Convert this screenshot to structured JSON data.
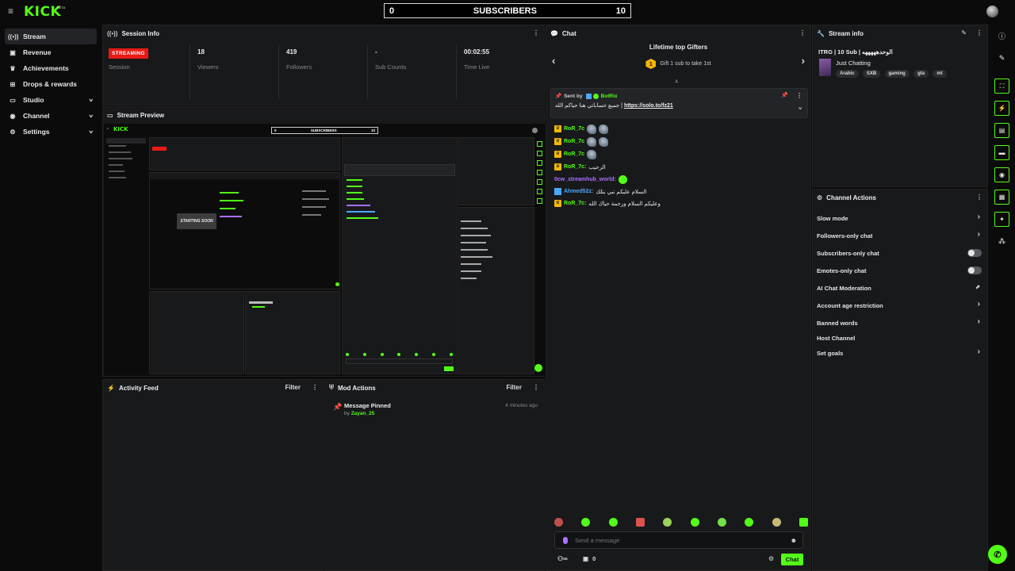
{
  "brand": {
    "logo": "KICK",
    "beta": "BETA",
    "accent": "#53fc18"
  },
  "goal": {
    "current": "0",
    "label": "SUBSCRIBERS",
    "target": "10"
  },
  "nav": {
    "items": [
      {
        "label": "Stream",
        "icon": "broadcast-icon",
        "active": true
      },
      {
        "label": "Revenue",
        "icon": "wallet-icon"
      },
      {
        "label": "Achievements",
        "icon": "trophy-icon"
      },
      {
        "label": "Drops & rewards",
        "icon": "drops-icon"
      },
      {
        "label": "Studio",
        "icon": "studio-icon",
        "expandable": true
      },
      {
        "label": "Channel",
        "icon": "channel-icon",
        "expandable": true
      },
      {
        "label": "Settings",
        "icon": "gear-icon",
        "expandable": true
      }
    ]
  },
  "session": {
    "title": "Session Info",
    "badge": "STREAMING",
    "badge_label": "Session",
    "viewers": "18",
    "viewers_label": "Viewers",
    "followers": "419",
    "followers_label": "Followers",
    "subs": "-",
    "subs_label": "Sub Counts",
    "time": "00:02:55",
    "time_label": "Time Live"
  },
  "preview": {
    "title": "Stream Preview"
  },
  "activity": {
    "title": "Activity Feed",
    "filter": "Filter"
  },
  "mod": {
    "title": "Mod Actions",
    "filter": "Filter",
    "entry": {
      "action": "Message Pinned",
      "by_prefix": "by",
      "user": "Zayan_25",
      "time": "4 minutes ago"
    }
  },
  "chat": {
    "title": "Chat",
    "gifter_title": "Lifetime top Gifters",
    "gift_rank": "1",
    "gift_text": "Gift 1 sub to take 1st",
    "pinned": {
      "sent_by": "Sent by",
      "user": "BotRix",
      "message": "جميع حساباتي هنا حياكم الله |",
      "link": "https://solo.to/fz21"
    },
    "messages": [
      {
        "user": "RoR_7c",
        "text": "",
        "emotes": 2,
        "kind": "crown"
      },
      {
        "user": "RoR_7c",
        "text": "",
        "emotes": 2,
        "kind": "crown"
      },
      {
        "user": "RoR_7c",
        "text": "",
        "emotes": 1,
        "kind": "crown"
      },
      {
        "user": "RoR_7c:",
        "text": "الرحيب",
        "emotes": 0,
        "kind": "crown"
      },
      {
        "user": "0cw_streamhub_world:",
        "text": "",
        "emotes": 0,
        "kind": "purple"
      },
      {
        "user": "Ahmed52z:",
        "text": "السلام عليكم تبي بتلك",
        "emotes": 0,
        "kind": "blue"
      },
      {
        "user": "RoR_7c:",
        "text": "وعليكم السلام ورحمة حياك الله",
        "emotes": 0,
        "kind": "crown"
      }
    ],
    "input_placeholder": "Send a message",
    "footer_count": "0",
    "send_label": "Chat"
  },
  "stream_info": {
    "title": "Stream info",
    "stream_title": "ITRG | 10 Sub | الوحدهههههه",
    "category": "Just Chatting",
    "tags": [
      "Arabic",
      "SXB",
      "gaming",
      "gta",
      "mt"
    ]
  },
  "channel_actions": {
    "title": "Channel Actions",
    "items": [
      {
        "label": "Slow mode",
        "control": "chevron"
      },
      {
        "label": "Followers-only chat",
        "control": "chevron"
      },
      {
        "label": "Subscribers-only chat",
        "control": "toggle"
      },
      {
        "label": "Emotes-only chat",
        "control": "toggle"
      },
      {
        "label": "AI Chat Moderation",
        "control": "external"
      },
      {
        "label": "Account age restriction",
        "control": "chevron"
      },
      {
        "label": "Banned words",
        "control": "chevron"
      },
      {
        "label": "Host Channel",
        "control": "none"
      },
      {
        "label": "Set goals",
        "control": "chevron"
      }
    ]
  },
  "mini_preview": {
    "starting": "STARTING SOON",
    "goal_left": "0",
    "goal_label": "SUBSCRIBERS",
    "goal_right": "10"
  }
}
